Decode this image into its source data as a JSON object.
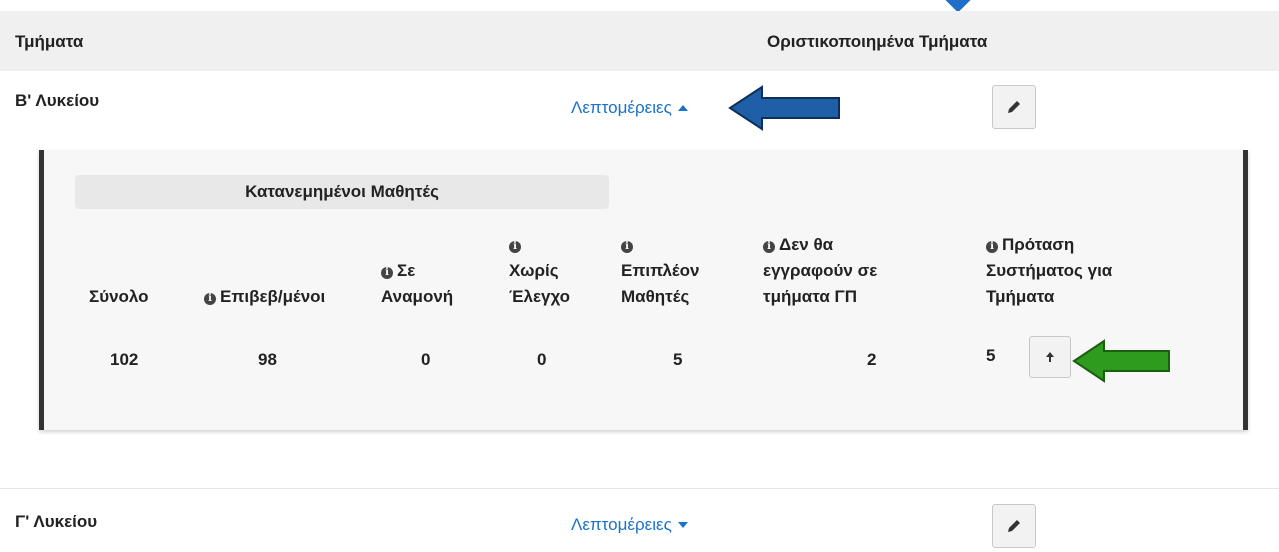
{
  "header": {
    "col_sections": "Τμήματα",
    "col_finalized": "Οριστικοποιημένα Τμήματα"
  },
  "rows": [
    {
      "title": "Β' Λυκείου",
      "details_label": "Λεπτομέρειες",
      "expanded": true,
      "panel": {
        "distributed_header": "Κατανεμημένοι Μαθητές",
        "columns": {
          "total": "Σύνολο",
          "confirmed": "Επιβεβ/μένοι",
          "pending_1": "Σε",
          "pending_2": "Αναμονή",
          "unchecked_1": "Χωρίς",
          "unchecked_2": "Έλεγχο",
          "extra_1": "Επιπλέον",
          "extra_2": "Μαθητές",
          "not_enrolled_1": "Δεν θα",
          "not_enrolled_2": "εγγραφούν σε",
          "not_enrolled_3": "τμήματα ΓΠ",
          "proposal_1": "Πρόταση",
          "proposal_2": "Συστήματος για",
          "proposal_3": "Τμήματα"
        },
        "values": {
          "total": "102",
          "confirmed": "98",
          "pending": "0",
          "unchecked": "0",
          "extra": "5",
          "not_enrolled": "2",
          "proposal": "5"
        }
      }
    },
    {
      "title": "Γ' Λυκείου",
      "details_label": "Λεπτομέρειες",
      "expanded": false
    }
  ],
  "colors": {
    "link": "#1a72c9",
    "annotation_blue": "#1f5fa8",
    "annotation_green": "#2e9a1e",
    "header_bg": "#f0f0f0",
    "panel_bg": "#f7f7f7"
  },
  "icons": {
    "edit": "pencil-icon",
    "apply": "arrow-up-icon",
    "info": "info-circle-icon",
    "caret_up": "caret-up-icon",
    "caret_down": "caret-down-icon"
  }
}
